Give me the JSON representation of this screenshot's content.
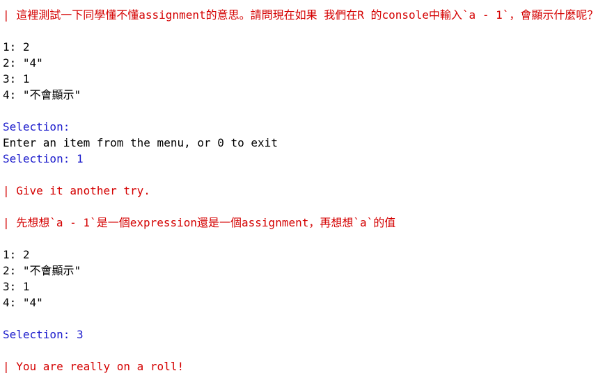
{
  "console": {
    "question": "| 這裡測試一下同學懂不懂assignment的意思。請問現在如果 我們在R 的console中輸入`a - 1`，會顯示什麼呢？",
    "menu1": [
      "1: 2",
      "2: \"4\"",
      "3: 1",
      "4: \"不會顯示\""
    ],
    "selection_label": "Selection:",
    "enter_prompt": "Enter an item from the menu, or 0 to exit",
    "selection_1": "Selection: 1",
    "feedback_try": "| Give it another try.",
    "hint": "| 先想想`a - 1`是一個expression還是一個assignment，再想想`a`的值",
    "menu2": [
      "1: 2",
      "2: \"不會顯示\"",
      "3: 1",
      "4: \"4\""
    ],
    "selection_3": "Selection: 3",
    "feedback_correct": "| You are really on a roll!"
  },
  "colors": {
    "swirl_red": "#d40000",
    "selection_blue": "#1a1acc",
    "text_black": "#000000",
    "background": "#ffffff"
  }
}
